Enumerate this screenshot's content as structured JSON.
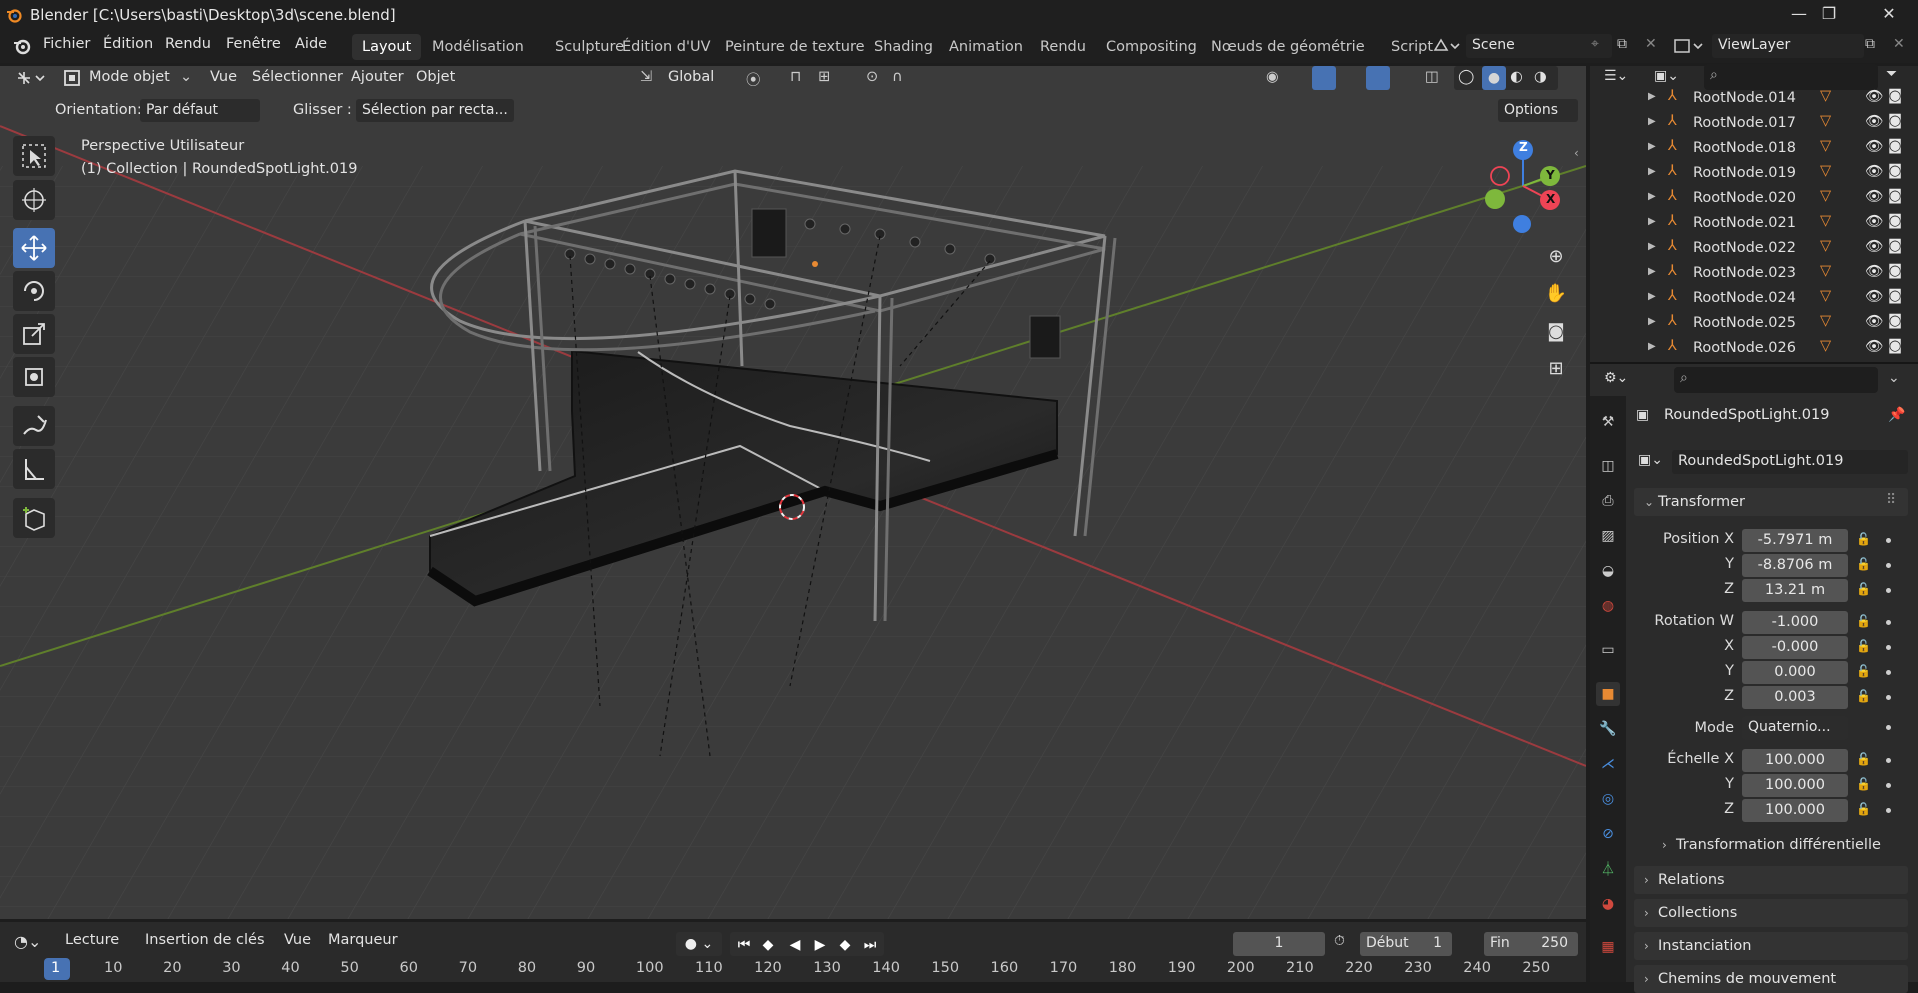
{
  "title": "Blender [C:\\Users\\basti\\Desktop\\3d\\scene.blend]",
  "menu": [
    "Fichier",
    "Édition",
    "Rendu",
    "Fenêtre",
    "Aide"
  ],
  "workspaces": [
    "Layout",
    "Modélisation",
    "Sculpture",
    "Édition d'UV",
    "Peinture de texture",
    "Shading",
    "Animation",
    "Rendu",
    "Compositing",
    "Nœuds de géométrie",
    "Script"
  ],
  "scene": "Scene",
  "view_layer": "ViewLayer",
  "viewport_header": {
    "mode": "Mode objet",
    "menus": [
      "Vue",
      "Sélectionner",
      "Ajouter",
      "Objet"
    ],
    "transform": "Global",
    "orientation_label": "Orientation:",
    "orientation_value": "Par défaut",
    "drag_label": "Glisser :",
    "drag_value": "Sélection par recta...",
    "options": "Options"
  },
  "viewport_info": {
    "line1": "Perspective Utilisateur",
    "line2": "(1) Collection | RoundedSpotLight.019"
  },
  "gizmo": {
    "x": "X",
    "y": "Y",
    "z": "Z"
  },
  "outliner": {
    "rows": [
      "RootNode.014",
      "RootNode.017",
      "RootNode.018",
      "RootNode.019",
      "RootNode.020",
      "RootNode.021",
      "RootNode.022",
      "RootNode.023",
      "RootNode.024",
      "RootNode.025",
      "RootNode.026"
    ]
  },
  "properties": {
    "object_name": "RoundedSpotLight.019",
    "object_field": "RoundedSpotLight.019",
    "transform_title": "Transformer",
    "position_label": "Position X",
    "position": [
      "-5.7971 m",
      "-8.8706 m",
      "13.21 m"
    ],
    "rotation_label": "Rotation W",
    "rotation": [
      "-1.000",
      "-0.000",
      "0.000",
      "0.003"
    ],
    "mode_label": "Mode",
    "mode_value": "Quaternio...",
    "scale_label": "Échelle X",
    "scale": [
      "100.000",
      "100.000",
      "100.000"
    ],
    "axis_y": "Y",
    "axis_z": "Z",
    "axis_x": "X",
    "delta": "Transformation différentielle",
    "panels": [
      "Relations",
      "Collections",
      "Instanciation",
      "Chemins de mouvement"
    ]
  },
  "timeline": {
    "menus": [
      "Lecture",
      "Insertion de clés",
      "Vue",
      "Marqueur"
    ],
    "current": "1",
    "start_label": "Début",
    "start": "1",
    "end_label": "Fin",
    "end": "250",
    "frames": [
      "1",
      "10",
      "20",
      "30",
      "40",
      "50",
      "60",
      "70",
      "80",
      "90",
      "100",
      "110",
      "120",
      "130",
      "140",
      "150",
      "160",
      "170",
      "180",
      "190",
      "200",
      "210",
      "220",
      "230",
      "240",
      "250"
    ]
  },
  "colors": {
    "accent": "#4772b3",
    "x_axis": "#ee4455",
    "y_axis": "#7eb83c",
    "z_axis": "#3f7fe0",
    "object_orange": "#e88a33"
  }
}
